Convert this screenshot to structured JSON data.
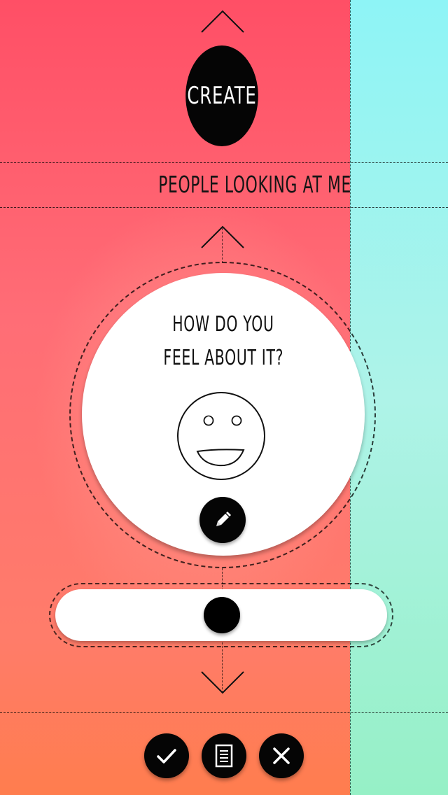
{
  "header": {
    "create_label": "CREATE",
    "up_chevron_icon": "chevron-up-icon"
  },
  "section": {
    "title": "PEOPLE LOOKING AT ME"
  },
  "question_card": {
    "line1": "HOW DO YOU",
    "line2": "FEEL ABOUT IT?",
    "face_icon": "smiley-face-icon",
    "edit_icon": "pencil-icon"
  },
  "slider": {
    "value": 0.5
  },
  "actions": [
    {
      "name": "confirm",
      "icon": "checkmark-icon"
    },
    {
      "name": "notes",
      "icon": "document-icon"
    },
    {
      "name": "cancel",
      "icon": "close-icon"
    }
  ],
  "colors": {
    "left_panel_top": "#ff4f66",
    "left_panel_bottom": "#ff7d4e",
    "right_panel_top": "#8ef4f6",
    "right_panel_bottom": "#96f0c6",
    "button_fill": "#050505",
    "card_fill": "#ffffff"
  }
}
